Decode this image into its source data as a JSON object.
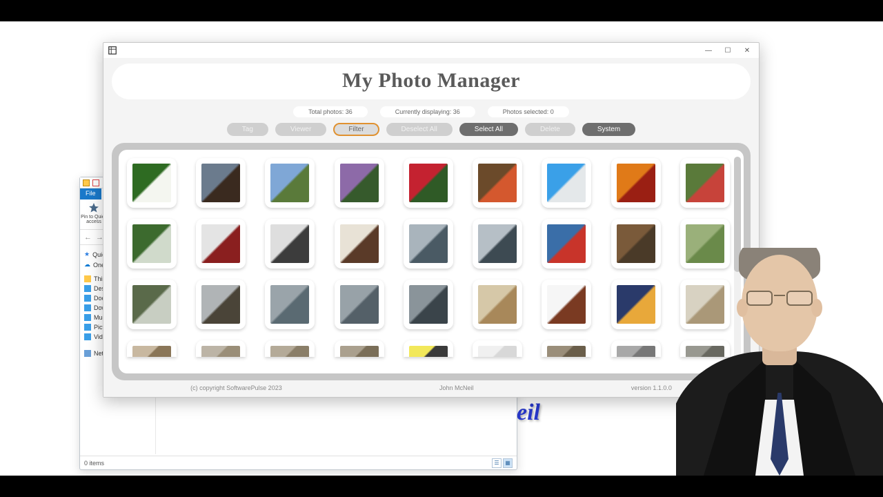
{
  "explorer": {
    "file_tab": "File",
    "pin_label": "Pin to Quick access",
    "items_status": "0 items",
    "network": "Network",
    "side_items": [
      "Quick access",
      "OneDrive",
      "This PC",
      "Desktop",
      "Documents",
      "Downloads",
      "Music",
      "Pictures",
      "Videos"
    ]
  },
  "pm": {
    "title": "My Photo Manager",
    "stats": {
      "total": "Total photos: 36",
      "displaying": "Currently displaying: 36",
      "selected": "Photos selected: 0"
    },
    "buttons": {
      "tag": "Tag",
      "viewer": "Viewer",
      "filter": "Filter",
      "deselect": "Deselect All",
      "selectall": "Select All",
      "delete": "Delete",
      "system": "System"
    },
    "footer": {
      "copyright": "(c) copyright SoftwarePulse 2023",
      "author": "John McNeil",
      "version": "version 1.1.0.0"
    },
    "thumbs": [
      {
        "c1": "#2e6b22",
        "c2": "#f4f6f0"
      },
      {
        "c1": "#6b7b8d",
        "c2": "#3a2a1f"
      },
      {
        "c1": "#7fa7d6",
        "c2": "#5a7a3a"
      },
      {
        "c1": "#8d6aa8",
        "c2": "#365a2c"
      },
      {
        "c1": "#c42230",
        "c2": "#2f5a26"
      },
      {
        "c1": "#6b4a2a",
        "c2": "#d4582e"
      },
      {
        "c1": "#3aa0e8",
        "c2": "#e4e8ea"
      },
      {
        "c1": "#e07a18",
        "c2": "#9a1f13"
      },
      {
        "c1": "#5a7a3a",
        "c2": "#c7433a"
      },
      {
        "c1": "#3c6a2e",
        "c2": "#d0dacb"
      },
      {
        "c1": "#e4e4e4",
        "c2": "#8a1f1f"
      },
      {
        "c1": "#dedede",
        "c2": "#3c3c3c"
      },
      {
        "c1": "#e8e2d6",
        "c2": "#5a3a28"
      },
      {
        "c1": "#a9b4bc",
        "c2": "#4a5a64"
      },
      {
        "c1": "#b6bfc6",
        "c2": "#3d4a52"
      },
      {
        "c1": "#3a6ea8",
        "c2": "#c8342a"
      },
      {
        "c1": "#7a5a3a",
        "c2": "#4a3a28"
      },
      {
        "c1": "#9ab07a",
        "c2": "#6a8a4a"
      },
      {
        "c1": "#5a6a4a",
        "c2": "#c8cec2"
      },
      {
        "c1": "#b0b4b6",
        "c2": "#4a4438"
      },
      {
        "c1": "#9aa4aa",
        "c2": "#5a6a72"
      },
      {
        "c1": "#98a2a8",
        "c2": "#546068"
      },
      {
        "c1": "#8a949a",
        "c2": "#3a444a"
      },
      {
        "c1": "#d6c8a8",
        "c2": "#a8885a"
      },
      {
        "c1": "#f6f6f6",
        "c2": "#7a3a22"
      },
      {
        "c1": "#2a3a6a",
        "c2": "#e8a83a"
      },
      {
        "c1": "#d8d2c2",
        "c2": "#aa9878"
      },
      {
        "c1": "#c8b8a0",
        "c2": "#8a7658"
      },
      {
        "c1": "#bcb4a6",
        "c2": "#9a8e78"
      },
      {
        "c1": "#b4aa98",
        "c2": "#8a7e68"
      },
      {
        "c1": "#aaa08e",
        "c2": "#7a6e58"
      },
      {
        "c1": "#f2e85a",
        "c2": "#3a3a3a"
      },
      {
        "c1": "#f0f0f0",
        "c2": "#d8d8d8"
      },
      {
        "c1": "#9a8e7a",
        "c2": "#6a5e4a"
      },
      {
        "c1": "#a8a8a8",
        "c2": "#787878"
      },
      {
        "c1": "#989890",
        "c2": "#686860"
      }
    ]
  },
  "fragment": "eil"
}
